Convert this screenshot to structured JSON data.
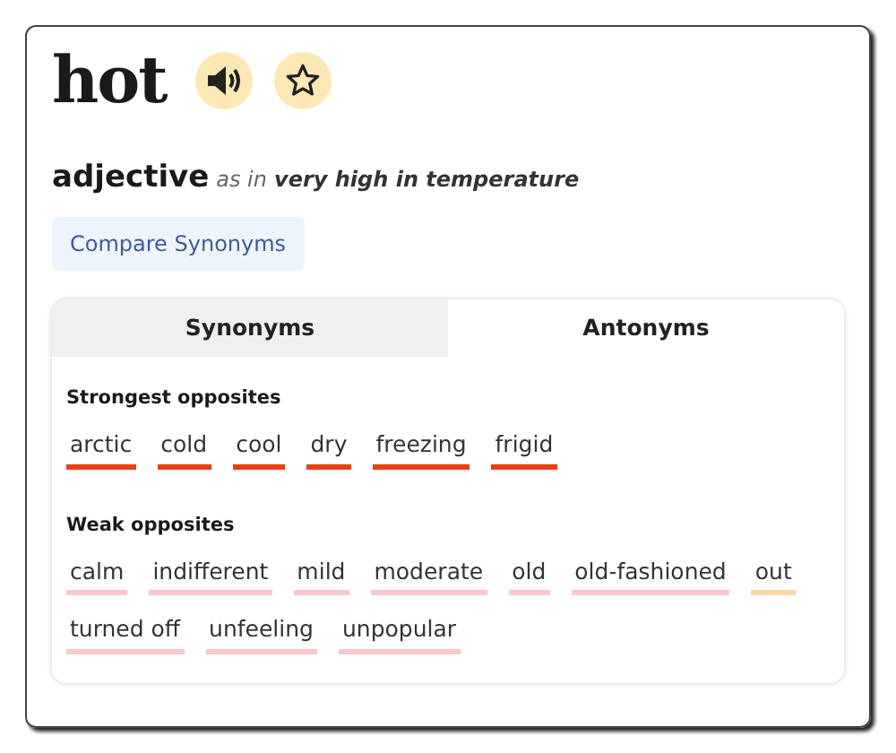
{
  "word": "hot",
  "part_of_speech": "adjective",
  "sense": {
    "prefix": "as in",
    "meaning": "very high in temperature"
  },
  "compare_button": "Compare Synonyms",
  "tabs": [
    {
      "label": "Synonyms",
      "selected": false
    },
    {
      "label": "Antonyms",
      "selected": true
    }
  ],
  "groups": [
    {
      "heading": "Strongest opposites",
      "words": [
        {
          "text": "arctic",
          "color": "#e8400f"
        },
        {
          "text": "cold",
          "color": "#e8400f"
        },
        {
          "text": "cool",
          "color": "#e8400f"
        },
        {
          "text": "dry",
          "color": "#e8400f"
        },
        {
          "text": "freezing",
          "color": "#e8400f"
        },
        {
          "text": "frigid",
          "color": "#e8400f"
        }
      ]
    },
    {
      "heading": "Weak opposites",
      "words": [
        {
          "text": "calm",
          "color": "#f8c8cc"
        },
        {
          "text": "indifferent",
          "color": "#f8c8cc"
        },
        {
          "text": "mild",
          "color": "#f8c8cc"
        },
        {
          "text": "moderate",
          "color": "#f8c8cc"
        },
        {
          "text": "old",
          "color": "#f8c8cc"
        },
        {
          "text": "old-fashioned",
          "color": "#f8c8cc"
        },
        {
          "text": "out",
          "color": "#fbd6a6"
        },
        {
          "text": "turned off",
          "color": "#f8c8cc"
        },
        {
          "text": "unfeeling",
          "color": "#f8c8cc"
        },
        {
          "text": "unpopular",
          "color": "#f8c8cc"
        }
      ]
    }
  ]
}
